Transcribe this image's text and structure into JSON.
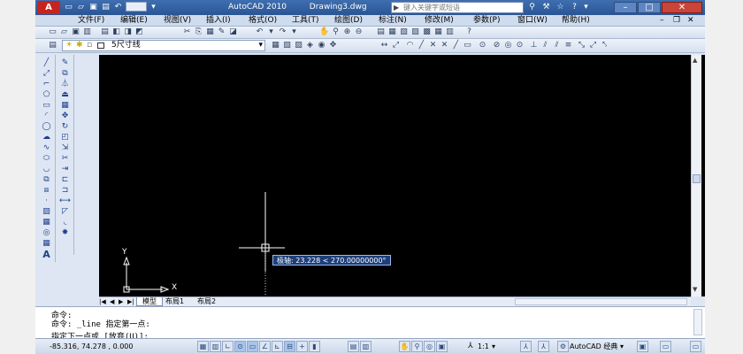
{
  "app": {
    "name": "AutoCAD 2010",
    "filename": "Drawing3.dwg",
    "search_placeholder": "键入关键字或短语"
  },
  "menu": [
    "文件(F)",
    "编辑(E)",
    "视图(V)",
    "插入(I)",
    "格式(O)",
    "工具(T)",
    "绘图(D)",
    "标注(N)",
    "修改(M)",
    "参数(P)",
    "窗口(W)",
    "帮助(H)"
  ],
  "layer": {
    "current": "5尺寸线"
  },
  "icons": {
    "standard": [
      "new-icon",
      "open-icon",
      "save-icon",
      "print-icon",
      "preview-icon",
      "publish-icon",
      "cut-icon",
      "copy-icon",
      "paste-icon",
      "matchprop-icon",
      "undo-icon",
      "redo-icon",
      "pan-icon",
      "zoom-realtime-icon",
      "zoom-window-icon",
      "zoom-previous-icon",
      "properties-icon",
      "design-center-icon",
      "tool-palette-icon",
      "sheetset-icon",
      "markup-icon",
      "calculator-icon",
      "help-icon"
    ],
    "draw": [
      "line-icon",
      "xline-icon",
      "polyline-icon",
      "polygon-icon",
      "rectangle-icon",
      "arc-icon",
      "circle-icon",
      "revcloud-icon",
      "spline-icon",
      "ellipse-icon",
      "ellipse-arc-icon",
      "insert-block-icon",
      "make-block-icon",
      "point-icon",
      "hatch-icon",
      "gradient-icon",
      "region-icon",
      "table-icon",
      "mtext-icon"
    ],
    "modify": [
      "erase-icon",
      "copy-object-icon",
      "mirror-icon",
      "offset-icon",
      "array-icon",
      "move-icon",
      "rotate-icon",
      "scale-icon",
      "stretch-icon",
      "trim-icon",
      "extend-icon",
      "break-point-icon",
      "break-icon",
      "join-icon",
      "chamfer-icon",
      "fillet-icon",
      "explode-icon"
    ],
    "status": [
      "snap-icon",
      "grid-icon",
      "ortho-icon",
      "polar-icon",
      "osnap-icon",
      "otrack-icon",
      "ducs-icon",
      "dyn-icon",
      "lineweight-icon",
      "qp-icon",
      "model-icon",
      "layout-icon",
      "pan-status-icon",
      "zoom-status-icon",
      "annotation-scale-icon",
      "workspace-icon",
      "lock-icon",
      "clean-screen-icon"
    ]
  },
  "tooltip": {
    "text": "极轴: 23.228  < 270.00000000°"
  },
  "ucs": {
    "x_label": "X",
    "y_label": "Y"
  },
  "tabs": [
    "模型",
    "布局1",
    "布局2"
  ],
  "command": {
    "lines": [
      "命令:",
      "命令: _line 指定第一点:"
    ],
    "prompt": "指定下一点或 [放弃(U)]:"
  },
  "status": {
    "coords": "-85.316,  74.278 , 0.000",
    "annotation_scale": "1:1",
    "workspace": "AutoCAD 经典"
  }
}
